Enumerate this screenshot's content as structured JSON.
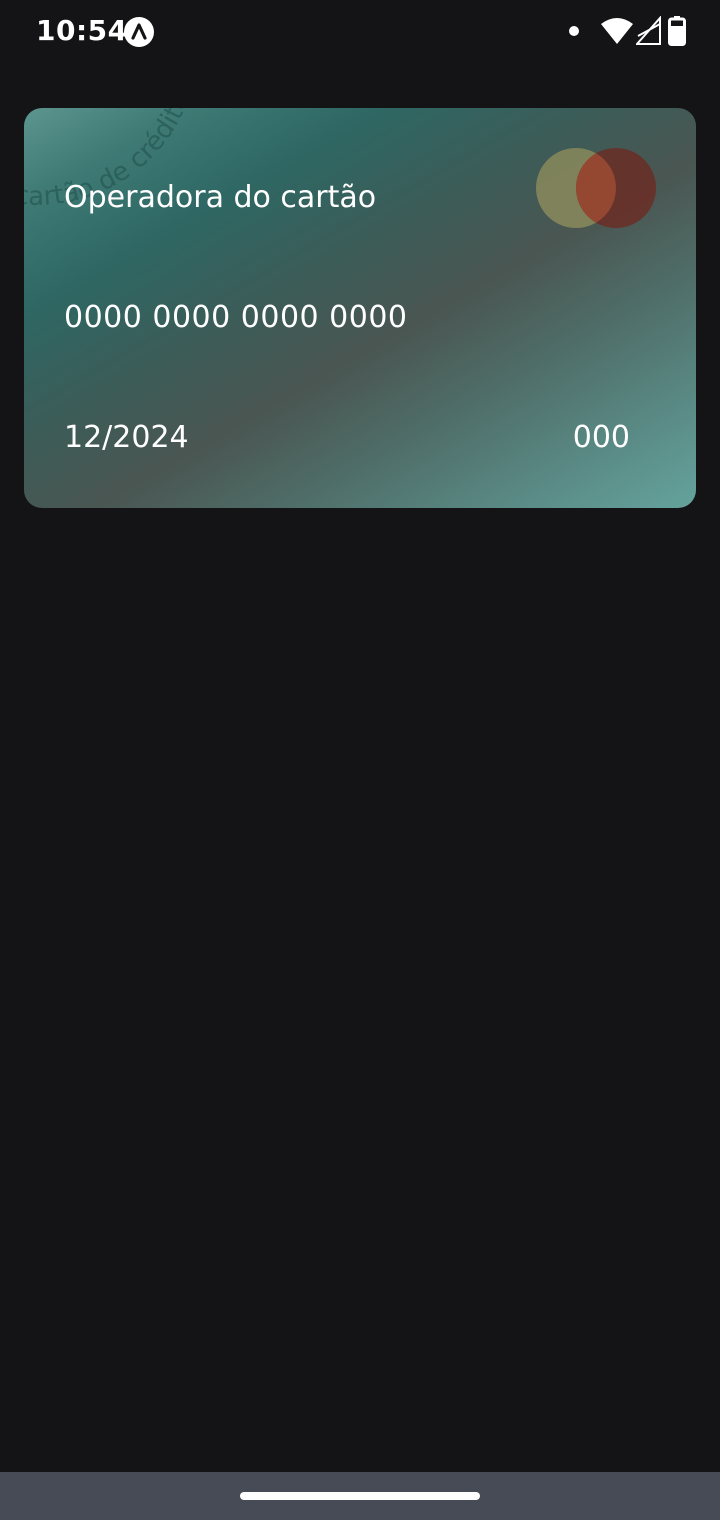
{
  "status_bar": {
    "time": "10:54",
    "icons": [
      "app-logo-icon",
      "notification-dot-icon",
      "wifi-icon",
      "signal-icon",
      "battery-icon"
    ]
  },
  "card": {
    "brand_name": "Operadora do cartão",
    "number": "0000 0000 0000 0000",
    "expiry": "12/2024",
    "cvv": "000",
    "watermark": "cartão de crédito",
    "logo": "mastercard-logo-icon",
    "colors": {
      "gradient_dark": "#2e6763",
      "gradient_light": "#65a39d",
      "logo_left": "#8a8a5c",
      "logo_right": "#6b2a22"
    }
  },
  "nav_bar": {
    "color": "#464b55"
  }
}
